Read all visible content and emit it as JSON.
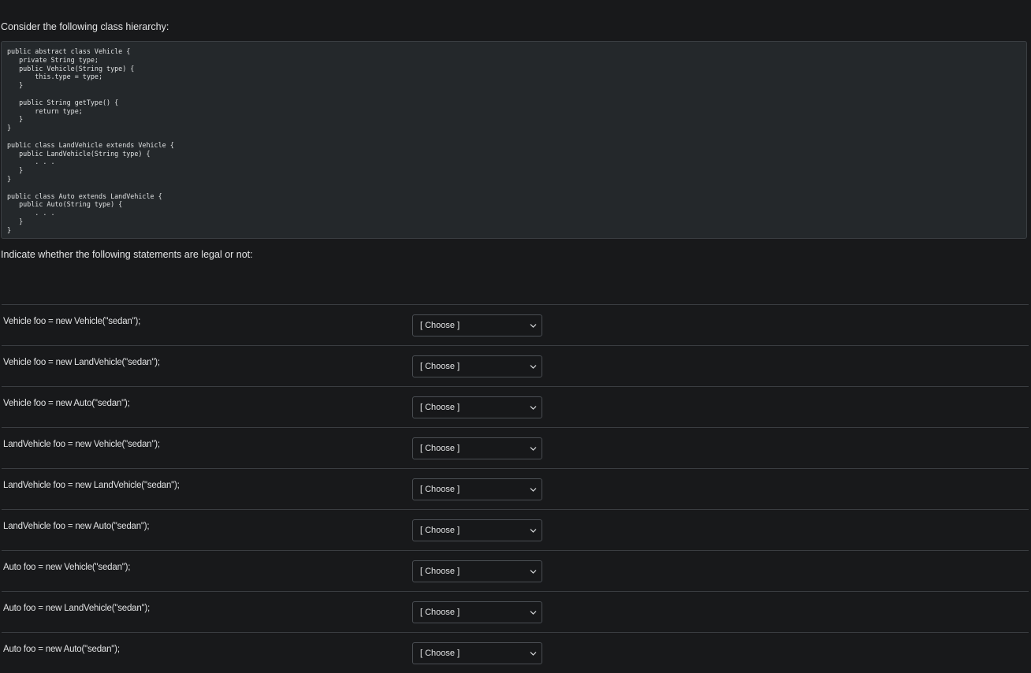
{
  "intro_text": "Consider the following class hierarchy:",
  "code": "public abstract class Vehicle {\n   private String type;\n   public Vehicle(String type) {\n       this.type = type;\n   }\n\n   public String getType() {\n       return type;\n   }\n}\n\npublic class LandVehicle extends Vehicle {\n   public LandVehicle(String type) {\n       . . .\n   }\n}\n\npublic class Auto extends LandVehicle {\n   public Auto(String type) {\n       . . .\n   }\n}",
  "instruction_text": "Indicate whether the following statements are legal or not:",
  "questions": [
    {
      "statement": "Vehicle foo = new Vehicle(\"sedan\");",
      "selected": "[ Choose ]"
    },
    {
      "statement": "Vehicle foo = new LandVehicle(\"sedan\");",
      "selected": "[ Choose ]"
    },
    {
      "statement": "Vehicle foo = new Auto(\"sedan\");",
      "selected": "[ Choose ]"
    },
    {
      "statement": "LandVehicle foo = new Vehicle(\"sedan\");",
      "selected": "[ Choose ]"
    },
    {
      "statement": "LandVehicle foo = new LandVehicle(\"sedan\");",
      "selected": "[ Choose ]"
    },
    {
      "statement": "LandVehicle foo = new Auto(\"sedan\");",
      "selected": "[ Choose ]"
    },
    {
      "statement": "Auto foo = new Vehicle(\"sedan\");",
      "selected": "[ Choose ]"
    },
    {
      "statement": "Auto foo = new LandVehicle(\"sedan\");",
      "selected": "[ Choose ]"
    },
    {
      "statement": "Auto foo = new Auto(\"sedan\");",
      "selected": "[ Choose ]"
    }
  ],
  "icons": {
    "dropdown": "chevron-down-icon"
  },
  "colors": {
    "background": "#18191b",
    "code_background": "#24282b",
    "text": "#e4e5e6",
    "border": "#3a3d41"
  }
}
